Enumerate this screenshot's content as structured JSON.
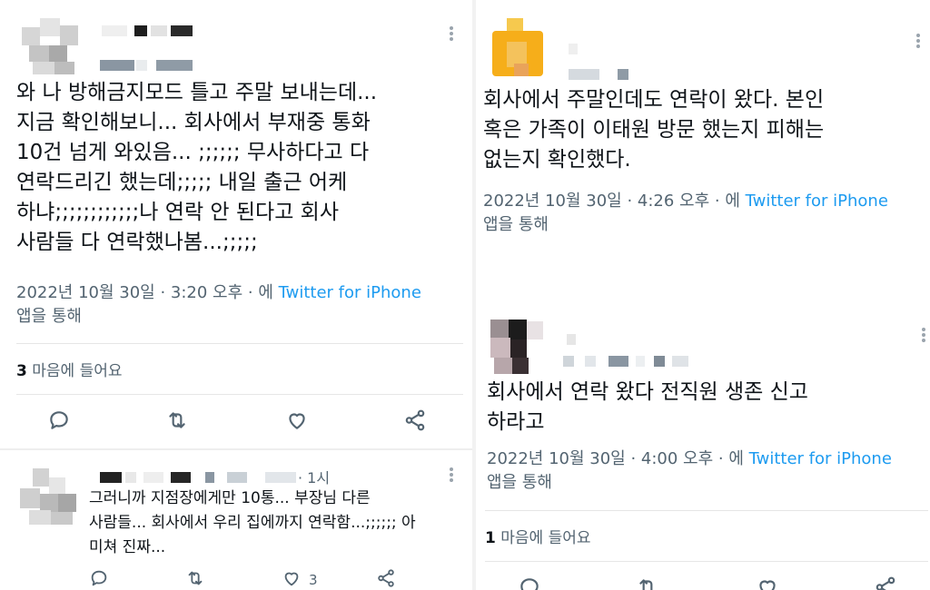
{
  "left_panel": {
    "main_tweet": {
      "text": "와 나 방해금지모드 틀고 주말 보내는데...\n지금 확인해보니... 회사에서 부재중 통화\n10건 넘게 와있음... ;;;;;; 무사하다고 다\n연락드리긴 했는데;;;;; 내일 출근 어케\n하냐;;;;;;;;;;;;나 연락 안 된다고 회사\n사람들 다 연락했나봄...;;;;;",
      "timestamp": "2022년 10월 30일 · 3:20 오후 · 에 ",
      "source": "Twitter for iPhone",
      "via": "앱을 통해",
      "likes_count": "3",
      "likes_label": " 마음에 들어요"
    },
    "reply": {
      "time": "· 1시",
      "text": "그러니까 지점장에게만 10통... 부장님 다른\n사람들... 회사에서 우리 집에까지 연락함...;;;;;; 아\n미쳐 진짜...",
      "like_count": "3"
    }
  },
  "right_panel": {
    "tweet_a": {
      "text": "회사에서 주말인데도 연락이 왔다. 본인\n혹은 가족이 이태원 방문 했는지 피해는\n없는지 확인했다.",
      "timestamp": "2022년 10월 30일 · 4:26 오후 · 에 ",
      "source": "Twitter for iPhone",
      "via": "앱을 통해"
    },
    "tweet_b": {
      "text": "회사에서 연락 왔다 전직원 생존 신고\n하라고",
      "timestamp": "2022년 10월 30일 · 4:00 오후 · 에 ",
      "source": "Twitter for iPhone",
      "via": "앱을 통해",
      "likes_count": "1",
      "likes_label": " 마음에 들어요"
    }
  },
  "icons": [
    "reply-icon",
    "retweet-icon",
    "like-icon",
    "share-icon",
    "more-icon"
  ],
  "colors": {
    "link": "#1d9bf0",
    "muted": "#536471",
    "text": "#0f1419"
  }
}
